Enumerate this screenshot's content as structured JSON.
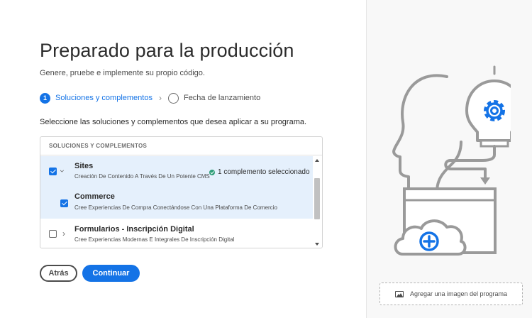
{
  "page": {
    "title": "Preparado para la producción",
    "subtitle": "Genere, pruebe e implemente su propio código."
  },
  "stepper": {
    "steps": [
      {
        "number": "1",
        "label": "Soluciones y complementos",
        "active": true
      },
      {
        "number": "",
        "label": "Fecha de lanzamiento",
        "active": false
      }
    ]
  },
  "instructions": "Seleccione las soluciones y complementos que desea aplicar a su programa.",
  "panel": {
    "header": "SOLUCIONES Y COMPLEMENTOS",
    "items": [
      {
        "title": "Sites",
        "description": "Creación De Contenido A Través De Un Potente CMS",
        "checked": true,
        "expanded": true,
        "status": "1 complemento seleccionado"
      },
      {
        "title": "Commerce",
        "description": "Cree Experiencias De Compra Conectándose Con Una Plataforma De Comercio",
        "checked": true
      },
      {
        "title": "Formularios - Inscripción Digital",
        "description": "Cree Experiencias Modernas E Integrales De Inscripción Digital",
        "checked": false,
        "expanded": false
      }
    ]
  },
  "buttons": {
    "back": "Atrás",
    "continue": "Continuar"
  },
  "upload": {
    "label": "Agregar una imagen del programa"
  },
  "colors": {
    "accent": "#1473e6",
    "success": "#2d9d78",
    "selected_row": "#e5f0fc"
  }
}
